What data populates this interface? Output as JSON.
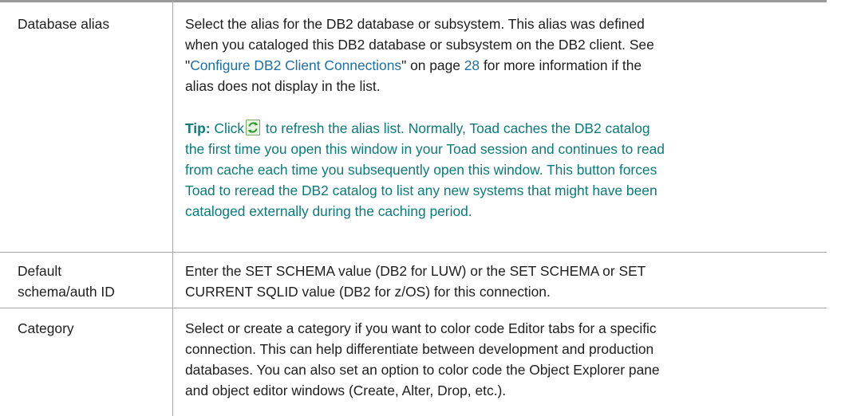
{
  "rows": [
    {
      "term": "Database alias",
      "description_lines": [
        "Select the alias for the DB2 database or subsystem. This alias was defined",
        "when you cataloged this DB2 database or subsystem on the DB2 client. See"
      ],
      "see_prefix": "\"",
      "see_link": "Configure DB2 Client Connections",
      "see_middle": "\" on page ",
      "see_page": "28",
      "see_suffix": " for more information if the",
      "description_last": "alias does not display in the list.",
      "tip": {
        "label": "Tip:",
        "click_text": " Click",
        "after_icon": " to refresh the alias list. Normally, Toad caches the DB2 catalog",
        "lines": [
          "the first time you open this window in your Toad session and continues to read",
          "from cache each time you subsequently open this window. This button forces",
          "Toad to reread the DB2 catalog to list any new systems that might have been",
          "cataloged externally during the caching period."
        ],
        "icon": "refresh-icon"
      }
    },
    {
      "term_lines": [
        "Default",
        "schema/auth ID"
      ],
      "description_lines": [
        "Enter the SET SCHEMA value (DB2 for LUW) or the SET SCHEMA or SET",
        "CURRENT SQLID value (DB2 for z/OS) for this connection."
      ]
    },
    {
      "term": "Category",
      "description_lines": [
        "Select or create a category if you want to color code Editor tabs for a specific",
        "connection. This can help differentiate between development and production",
        "databases. You can also set an option to color code the Object Explorer pane",
        "and object editor windows (Create, Alter, Drop, etc.)."
      ]
    }
  ],
  "colors": {
    "link": "#1f6fa3",
    "tip": "#0d7a7a",
    "rule": "#a6a6a6"
  }
}
